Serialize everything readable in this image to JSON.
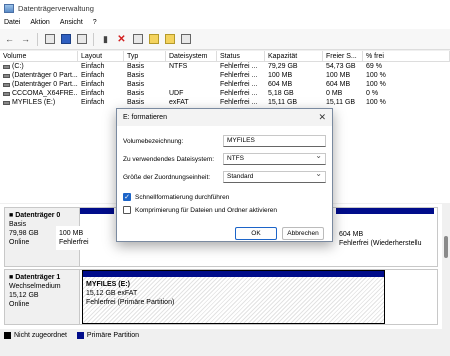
{
  "window": {
    "title": "Datenträgerverwaltung"
  },
  "menu": [
    "Datei",
    "Aktion",
    "Ansicht",
    "?"
  ],
  "toolbar_icons": [
    "back-icon",
    "forward-icon",
    "view-icon",
    "help-icon",
    "properties-icon",
    "connect-icon",
    "delete-icon",
    "check-icon",
    "new-icon",
    "folder-icon",
    "volume-icon"
  ],
  "volume_table": {
    "columns": [
      "Volume",
      "Layout",
      "Typ",
      "Dateisystem",
      "Status",
      "Kapazität",
      "Freier S...",
      "% frei"
    ],
    "rows": [
      [
        "(C:)",
        "Einfach",
        "Basis",
        "NTFS",
        "Fehlerfrei ...",
        "79,29 GB",
        "54,73 GB",
        "69 %"
      ],
      [
        "(Datenträger 0 Part...",
        "Einfach",
        "Basis",
        "",
        "Fehlerfrei ...",
        "100 MB",
        "100 MB",
        "100 %"
      ],
      [
        "(Datenträger 0 Part...",
        "Einfach",
        "Basis",
        "",
        "Fehlerfrei ...",
        "604 MB",
        "604 MB",
        "100 %"
      ],
      [
        "CCCOMA_X64FRE...",
        "Einfach",
        "Basis",
        "UDF",
        "Fehlerfrei ...",
        "5,18 GB",
        "0 MB",
        "0 %"
      ],
      [
        "MYFILES (E:)",
        "Einfach",
        "Basis",
        "exFAT",
        "Fehlerfrei ...",
        "15,11 GB",
        "15,11 GB",
        "100 %"
      ]
    ]
  },
  "disks": [
    {
      "name": "Datenträger 0",
      "type": "Basis",
      "size": "79,98 GB",
      "status": "Online",
      "partitions": [
        {
          "line1": "100 MB",
          "line2": "Fehlerfrei"
        },
        {
          "line1": "604 MB",
          "line2": "Fehlerfrei (Wiederherstellu"
        }
      ]
    },
    {
      "name": "Datenträger 1",
      "type": "Wechselmedium",
      "size": "15,12 GB",
      "status": "Online",
      "partitions": [
        {
          "name": "MYFILES  (E:)",
          "line1": "15,12 GB exFAT",
          "line2": "Fehlerfrei (Primäre Partition)"
        }
      ]
    }
  ],
  "legend": [
    {
      "label": "Nicht zugeordnet",
      "color": "#000000"
    },
    {
      "label": "Primäre Partition",
      "color": "#000c8a"
    }
  ],
  "dialog": {
    "title": "E: formatieren",
    "fields": {
      "volume_label": {
        "label": "Volumebezeichnung:",
        "value": "MYFILES"
      },
      "filesystem": {
        "label": "Zu verwendendes Dateisystem:",
        "value": "NTFS"
      },
      "alloc_size": {
        "label": "Größe der Zuordnungseinheit:",
        "value": "Standard"
      }
    },
    "quick_format": {
      "label": "Schnellformatierung durchführen",
      "checked": true
    },
    "compression": {
      "label": "Komprimierung für Dateien und Ordner aktivieren",
      "checked": false
    },
    "ok_label": "OK",
    "cancel_label": "Abbrechen"
  }
}
